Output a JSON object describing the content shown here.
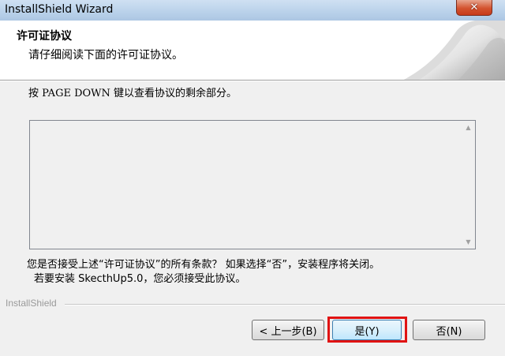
{
  "window": {
    "title": "InstallShield Wizard",
    "close_glyph": "✕"
  },
  "header": {
    "title": "许可证协议",
    "subtitle": "请仔细阅读下面的许可证协议。"
  },
  "instructions": "按 PAGE DOWN 键以查看协议的剩余部分。",
  "license_text": "",
  "question": {
    "line1": "您是否接受上述“许可证协议”的所有条款？  如果选择“否”，安装程序将关闭。",
    "line2": "若要安装 SkecthUp5.0，您必须接受此协议。"
  },
  "brand": "InstallShield",
  "buttons": {
    "back": "< 上一步(B)",
    "yes": "是(Y)",
    "no": "否(N)"
  },
  "colors": {
    "highlight": "#e01313",
    "title_bar": "#b9d1ea",
    "close_button": "#d3532f"
  }
}
